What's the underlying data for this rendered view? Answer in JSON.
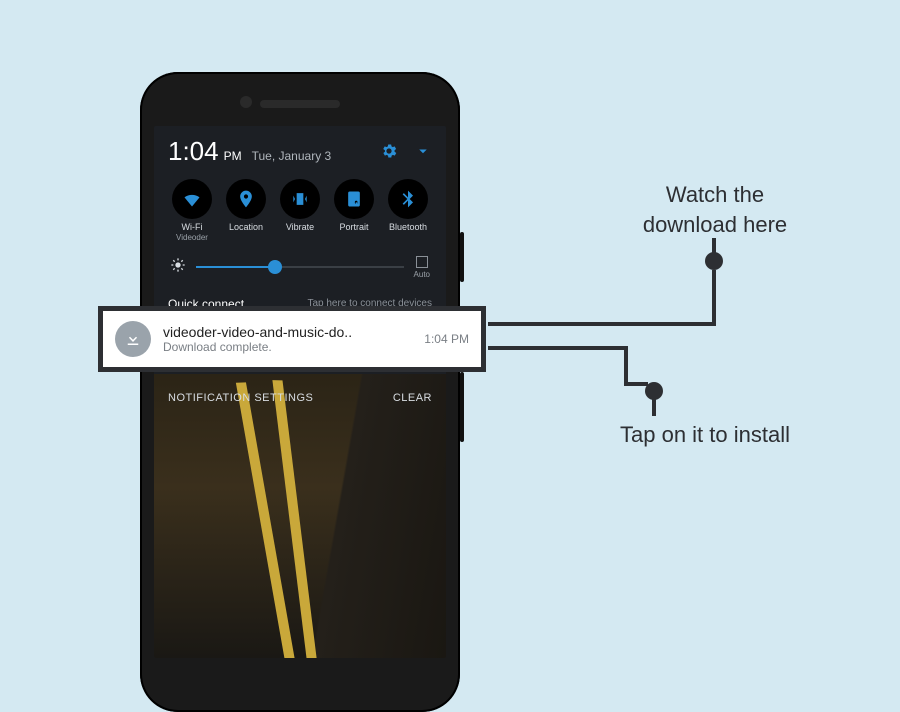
{
  "statusbar": {
    "time": "1:04",
    "ampm": "PM",
    "date": "Tue, January 3"
  },
  "quick_settings": [
    {
      "label": "Wi-Fi",
      "sublabel": "Videoder",
      "icon": "wifi"
    },
    {
      "label": "Location",
      "sublabel": "",
      "icon": "location"
    },
    {
      "label": "Vibrate",
      "sublabel": "",
      "icon": "vibrate"
    },
    {
      "label": "Portrait",
      "sublabel": "",
      "icon": "portrait"
    },
    {
      "label": "Bluetooth",
      "sublabel": "",
      "icon": "bluetooth"
    }
  ],
  "brightness": {
    "auto_label": "Auto",
    "value_pct": 38
  },
  "quick_connect": {
    "title": "Quick connect",
    "hint": "Tap here to connect devices"
  },
  "shade_footer": {
    "settings": "NOTIFICATION SETTINGS",
    "clear": "CLEAR"
  },
  "notification": {
    "title": "videoder-video-and-music-do..",
    "subtitle": "Download complete.",
    "time": "1:04 PM"
  },
  "annotations": {
    "a1": "Watch the download here",
    "a2": "Tap on it to install"
  }
}
